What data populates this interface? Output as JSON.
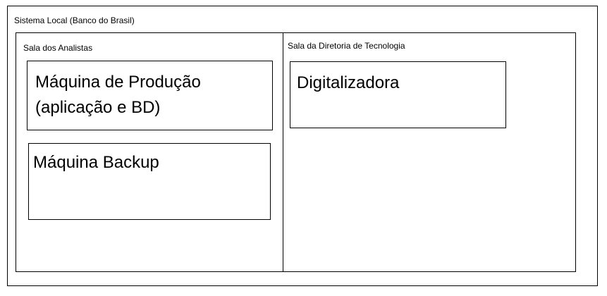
{
  "system": {
    "label": "Sistema Local (Banco do Brasil)"
  },
  "rooms": [
    {
      "label": "Sala dos Analistas",
      "machines": [
        {
          "line1": "Máquina de Produção",
          "line2": "(aplicação e BD)"
        },
        {
          "line1": "Máquina Backup"
        }
      ]
    },
    {
      "label": "Sala da Diretoria de Tecnologia",
      "machines": [
        {
          "line1": "Digitalizadora"
        }
      ]
    }
  ]
}
